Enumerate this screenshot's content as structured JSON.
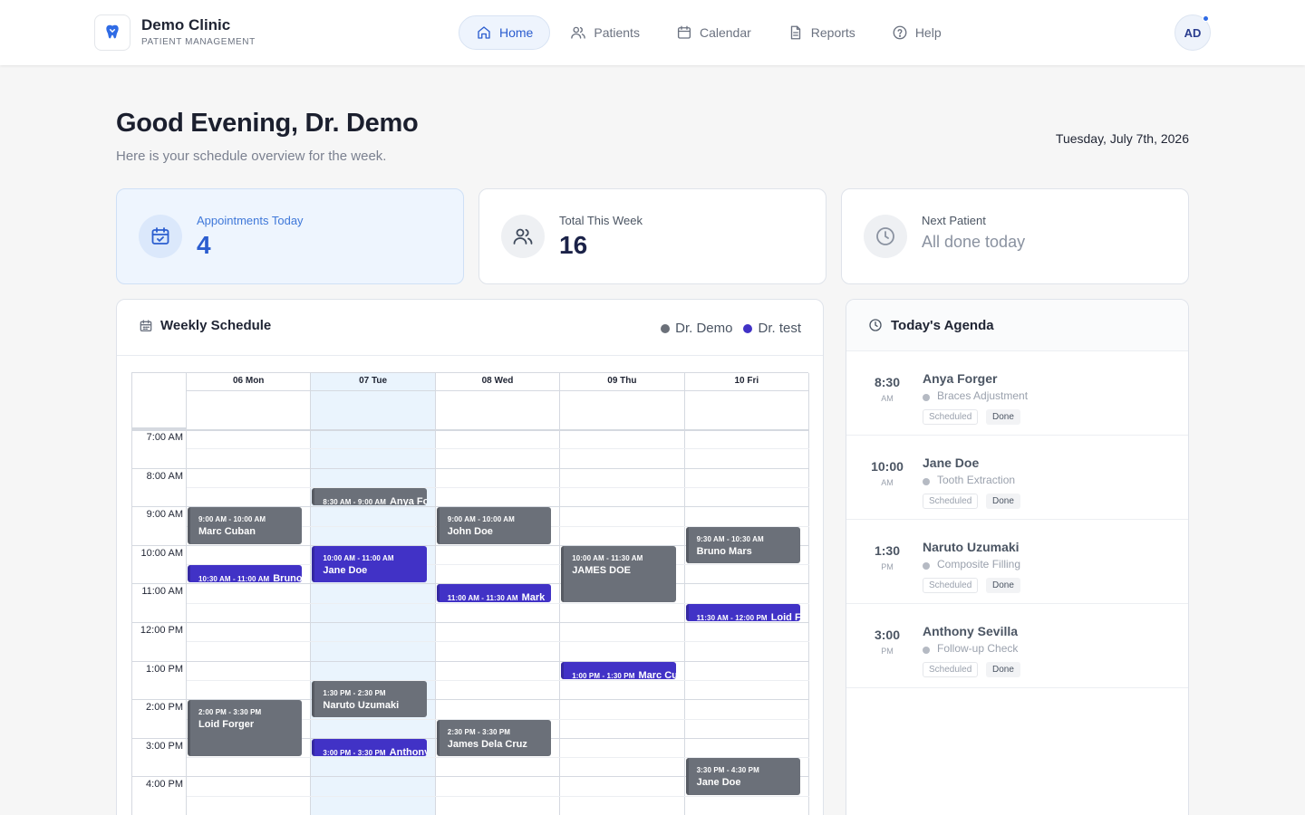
{
  "app": {
    "name": "Demo Clinic",
    "subtitle": "PATIENT MANAGEMENT",
    "avatar_initials": "AD"
  },
  "nav": [
    {
      "label": "Home",
      "icon": "home-icon",
      "active": true
    },
    {
      "label": "Patients",
      "icon": "users-icon",
      "active": false
    },
    {
      "label": "Calendar",
      "icon": "calendar-icon",
      "active": false
    },
    {
      "label": "Reports",
      "icon": "document-icon",
      "active": false
    },
    {
      "label": "Help",
      "icon": "help-circle-icon",
      "active": false
    }
  ],
  "greeting": {
    "title": "Good Evening, Dr. Demo",
    "subtitle": "Here is your schedule overview for the week.",
    "date": "Tuesday, July 7th, 2026"
  },
  "stats": [
    {
      "label": "Appointments Today",
      "value": "4",
      "icon": "calendar-check-icon"
    },
    {
      "label": "Total This Week",
      "value": "16",
      "icon": "users-icon"
    },
    {
      "label": "Next Patient",
      "value": "All done today",
      "icon": "clock-icon"
    }
  ],
  "schedule": {
    "title": "Weekly Schedule",
    "legend": [
      {
        "name": "Dr. Demo",
        "color": "#6b7079"
      },
      {
        "name": "Dr. test",
        "color": "#4132c6"
      }
    ],
    "days": [
      "06 Mon",
      "07 Tue",
      "08 Wed",
      "09 Thu",
      "10 Fri"
    ],
    "today_index": 1,
    "time_labels": [
      "7:00 AM",
      "8:00 AM",
      "9:00 AM",
      "10:00 AM",
      "11:00 AM",
      "12:00 PM",
      "1:00 PM",
      "2:00 PM",
      "3:00 PM",
      "4:00 PM"
    ],
    "events": [
      {
        "day": 0,
        "start": 9.0,
        "end": 10.0,
        "time": "9:00 AM - 10:00 AM",
        "name": "Marc Cuban",
        "doctor": "Dr. Demo"
      },
      {
        "day": 0,
        "start": 10.5,
        "end": 11.0,
        "time": "10:30 AM - 11:00 AM",
        "name": "Bruno Mars",
        "doctor": "Dr. test"
      },
      {
        "day": 0,
        "start": 14.0,
        "end": 15.5,
        "time": "2:00 PM - 3:30 PM",
        "name": "Loid Forger",
        "doctor": "Dr. Demo"
      },
      {
        "day": 1,
        "start": 8.5,
        "end": 9.0,
        "time": "8:30 AM - 9:00 AM",
        "name": "Anya Forger",
        "doctor": "Dr. Demo"
      },
      {
        "day": 1,
        "start": 10.0,
        "end": 11.0,
        "time": "10:00 AM - 11:00 AM",
        "name": "Jane Doe",
        "doctor": "Dr. test"
      },
      {
        "day": 1,
        "start": 13.5,
        "end": 14.5,
        "time": "1:30 PM - 2:30 PM",
        "name": "Naruto Uzumaki",
        "doctor": "Dr. Demo"
      },
      {
        "day": 1,
        "start": 15.0,
        "end": 15.5,
        "time": "3:00 PM - 3:30 PM",
        "name": "Anthony Sevilla",
        "doctor": "Dr. test"
      },
      {
        "day": 2,
        "start": 9.0,
        "end": 10.0,
        "time": "9:00 AM - 10:00 AM",
        "name": "John Doe",
        "doctor": "Dr. Demo"
      },
      {
        "day": 2,
        "start": 11.0,
        "end": 11.5,
        "time": "11:00 AM - 11:30 AM",
        "name": "Mark",
        "doctor": "Dr. test"
      },
      {
        "day": 2,
        "start": 14.5,
        "end": 15.5,
        "time": "2:30 PM - 3:30 PM",
        "name": "James Dela Cruz",
        "doctor": "Dr. Demo"
      },
      {
        "day": 3,
        "start": 10.0,
        "end": 11.5,
        "time": "10:00 AM - 11:30 AM",
        "name": "JAMES DOE",
        "doctor": "Dr. Demo"
      },
      {
        "day": 3,
        "start": 13.0,
        "end": 13.5,
        "time": "1:00 PM - 1:30 PM",
        "name": "Marc Cuban",
        "doctor": "Dr. test"
      },
      {
        "day": 4,
        "start": 9.5,
        "end": 10.5,
        "time": "9:30 AM - 10:30 AM",
        "name": "Bruno Mars",
        "doctor": "Dr. Demo"
      },
      {
        "day": 4,
        "start": 11.5,
        "end": 12.0,
        "time": "11:30 AM - 12:00 PM",
        "name": "Loid Forger",
        "doctor": "Dr. test"
      },
      {
        "day": 4,
        "start": 15.5,
        "end": 16.5,
        "time": "3:30 PM - 4:30 PM",
        "name": "Jane Doe",
        "doctor": "Dr. Demo"
      }
    ]
  },
  "agenda": {
    "title": "Today's Agenda",
    "items": [
      {
        "time": "8:30",
        "ampm": "AM",
        "name": "Anya Forger",
        "treatment": "Braces Adjustment",
        "status": "Scheduled",
        "action": "Done"
      },
      {
        "time": "10:00",
        "ampm": "AM",
        "name": "Jane Doe",
        "treatment": "Tooth Extraction",
        "status": "Scheduled",
        "action": "Done"
      },
      {
        "time": "1:30",
        "ampm": "PM",
        "name": "Naruto Uzumaki",
        "treatment": "Composite Filling",
        "status": "Scheduled",
        "action": "Done"
      },
      {
        "time": "3:00",
        "ampm": "PM",
        "name": "Anthony Sevilla",
        "treatment": "Follow-up Check",
        "status": "Scheduled",
        "action": "Done"
      }
    ]
  }
}
